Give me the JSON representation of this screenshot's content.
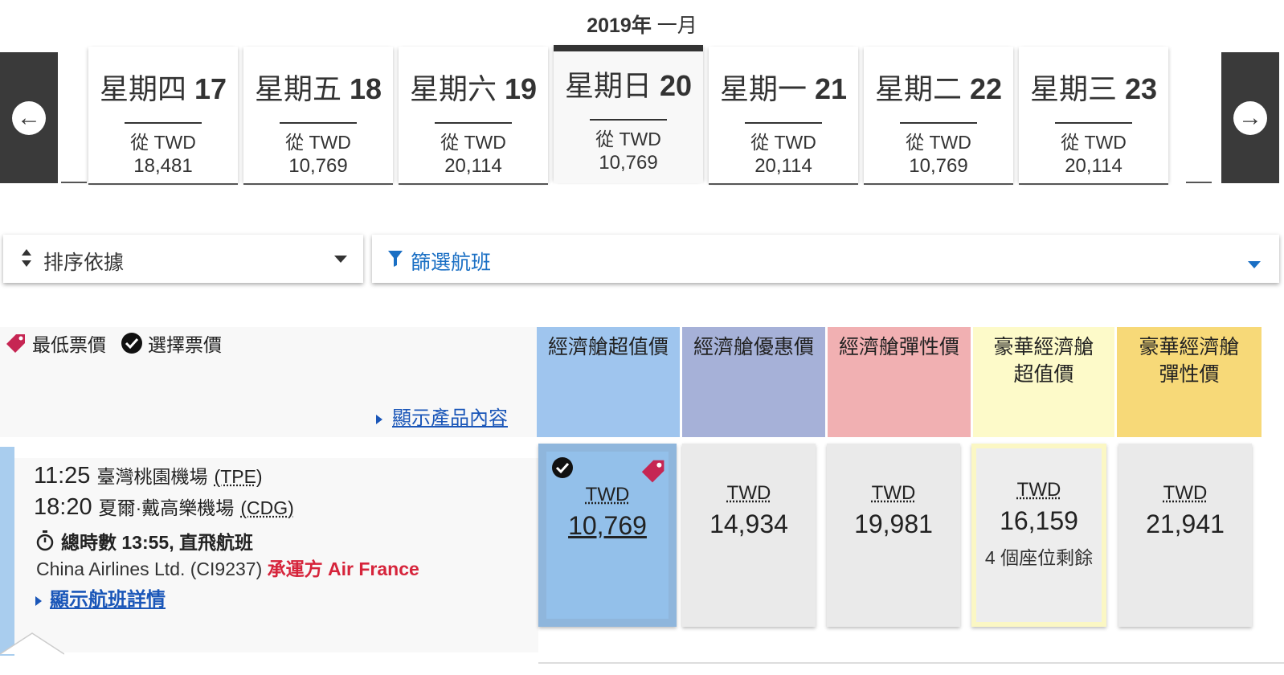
{
  "calendar": {
    "month_year": "2019年",
    "month_name": "一月",
    "prev_label": "←",
    "next_label": "→",
    "dates": [
      {
        "day_name": "星期四",
        "day_num": "17",
        "from": "從 TWD",
        "price": "18,481"
      },
      {
        "day_name": "星期五",
        "day_num": "18",
        "from": "從 TWD",
        "price": "10,769"
      },
      {
        "day_name": "星期六",
        "day_num": "19",
        "from": "從 TWD",
        "price": "20,114"
      },
      {
        "day_name": "星期日",
        "day_num": "20",
        "from": "從 TWD",
        "price": "10,769"
      },
      {
        "day_name": "星期一",
        "day_num": "21",
        "from": "從 TWD",
        "price": "20,114"
      },
      {
        "day_name": "星期二",
        "day_num": "22",
        "from": "從 TWD",
        "price": "10,769"
      },
      {
        "day_name": "星期三",
        "day_num": "23",
        "from": "從 TWD",
        "price": "20,114"
      }
    ]
  },
  "controls": {
    "sort_label": "排序依據",
    "filter_label": "篩選航班"
  },
  "legend": {
    "lowest_fare": "最低票價",
    "selected_fare": "選擇票價",
    "show_product": "顯示產品內容"
  },
  "cabins": [
    {
      "label": "經濟艙超值價",
      "color": "#9fc5ee"
    },
    {
      "label": "經濟艙優惠價",
      "color": "#a6b1d8"
    },
    {
      "label": "經濟艙彈性價",
      "color": "#f1b0b2"
    },
    {
      "label": "豪華經濟艙超值價",
      "color": "#fdfac9"
    },
    {
      "label": "豪華經濟艙彈性價",
      "color": "#f7d978"
    }
  ],
  "flight": {
    "dep_time": "11:25",
    "dep_airport": "臺灣桃園機場",
    "dep_code": "(TPE)",
    "arr_time": "18:20",
    "arr_airport": "夏爾·戴高樂機場",
    "arr_code": "(CDG)",
    "duration": "總時數 13:55, 直飛航班",
    "airline": "China Airlines Ltd. (CI9237)",
    "operated_by": "承運方 Air France",
    "details_link": "顯示航班詳情",
    "fares": [
      {
        "currency": "TWD",
        "amount": "10,769"
      },
      {
        "currency": "TWD",
        "amount": "14,934"
      },
      {
        "currency": "TWD",
        "amount": "19,981"
      },
      {
        "currency": "TWD",
        "amount": "16,159",
        "seats": "4 個座位剩餘"
      },
      {
        "currency": "TWD",
        "amount": "21,941"
      }
    ]
  }
}
